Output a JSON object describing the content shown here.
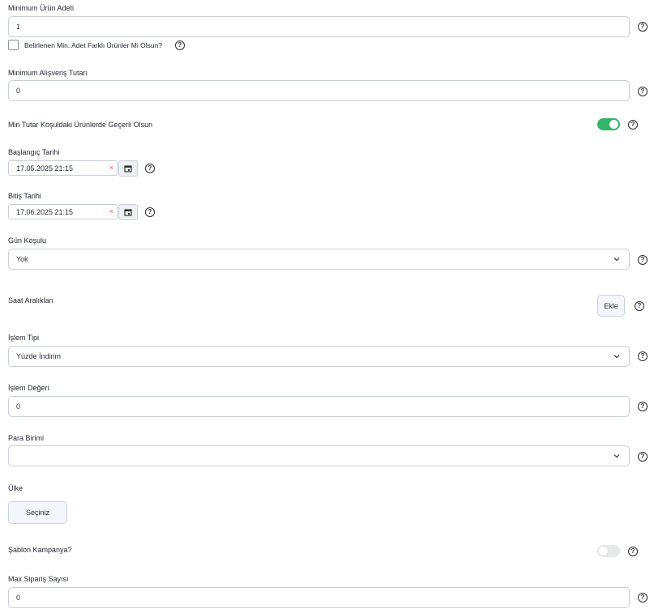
{
  "fields": {
    "min_urun_adeti": {
      "label": "Minimum Ürün Adeti",
      "value": "1"
    },
    "farkli_urunler": {
      "label": "Belirlenen Min. Adet Farklı Ürünler Mi Olsun?",
      "checked": false
    },
    "min_alisveris_tutari": {
      "label": "Minimum Alışveriş Tutarı",
      "value": "0"
    },
    "min_tutar_kosul": {
      "label": "Min Tutar Koşuldaki Ürünlerde Geçerli Olsun",
      "enabled": true
    },
    "baslangic_tarihi": {
      "label": "Başlangıç Tarihi",
      "value": "17.05.2025 21:15"
    },
    "bitis_tarihi": {
      "label": "Bitiş Tarihi",
      "value": "17.06.2025 21:15"
    },
    "gun_kosulu": {
      "label": "Gün Koşulu",
      "value": "Yok"
    },
    "saat_araliklari": {
      "label": "Saat Aralıkları",
      "button": "Ekle"
    },
    "islem_tipi": {
      "label": "İşlem Tipi",
      "value": "Yüzde İndirim"
    },
    "islem_degeri": {
      "label": "İşlem Değeri",
      "value": "0"
    },
    "para_birimi": {
      "label": "Para Birimi",
      "value": ""
    },
    "ulke": {
      "label": "Ülke",
      "button": "Seçiniz"
    },
    "sablon_kampanya": {
      "label": "Şablon Kampanya?",
      "enabled": false
    },
    "max_siparis_sayisi": {
      "label": "Max Sipariş Sayısı",
      "value": "0"
    }
  },
  "help_symbol": "?",
  "clear_symbol": "×",
  "icons": {
    "help": "question-circle-icon",
    "calendar": "calendar-icon",
    "chevron": "chevron-down-icon",
    "clear": "clear-x-icon"
  },
  "colors": {
    "toggle_on": "#34b36b",
    "toggle_off": "#e6e8eb",
    "border": "#c9ced6",
    "button_bg": "#f3f6fb"
  }
}
